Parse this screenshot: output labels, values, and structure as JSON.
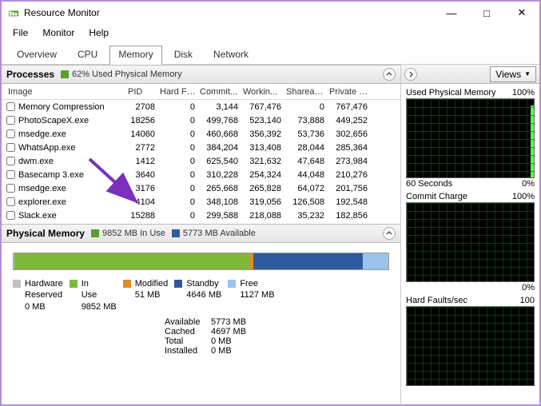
{
  "window": {
    "title": "Resource Monitor"
  },
  "menu": [
    "File",
    "Monitor",
    "Help"
  ],
  "tabs": {
    "items": [
      "Overview",
      "CPU",
      "Memory",
      "Disk",
      "Network"
    ],
    "active": 2
  },
  "processes": {
    "title": "Processes",
    "stat": {
      "color": "#5aa02c",
      "text": "62% Used Physical Memory"
    },
    "columns": [
      "Image",
      "PID",
      "Hard Fa...",
      "Commit...",
      "Workin...",
      "Shareab...",
      "Private (..."
    ],
    "rows": [
      {
        "image": "Memory Compression",
        "pid": "2708",
        "hard": "0",
        "commit": "3,144",
        "working": "767,476",
        "share": "0",
        "private": "767,476"
      },
      {
        "image": "PhotoScapeX.exe",
        "pid": "18256",
        "hard": "0",
        "commit": "499,768",
        "working": "523,140",
        "share": "73,888",
        "private": "449,252"
      },
      {
        "image": "msedge.exe",
        "pid": "14060",
        "hard": "0",
        "commit": "460,668",
        "working": "356,392",
        "share": "53,736",
        "private": "302,656"
      },
      {
        "image": "WhatsApp.exe",
        "pid": "2772",
        "hard": "0",
        "commit": "384,204",
        "working": "313,408",
        "share": "28,044",
        "private": "285,364"
      },
      {
        "image": "dwm.exe",
        "pid": "1412",
        "hard": "0",
        "commit": "625,540",
        "working": "321,632",
        "share": "47,648",
        "private": "273,984"
      },
      {
        "image": "Basecamp 3.exe",
        "pid": "3640",
        "hard": "0",
        "commit": "310,228",
        "working": "254,324",
        "share": "44,048",
        "private": "210,276"
      },
      {
        "image": "msedge.exe",
        "pid": "3176",
        "hard": "0",
        "commit": "265,668",
        "working": "265,828",
        "share": "64,072",
        "private": "201,756"
      },
      {
        "image": "explorer.exe",
        "pid": "4104",
        "hard": "0",
        "commit": "348,108",
        "working": "319,056",
        "share": "126,508",
        "private": "192,548"
      },
      {
        "image": "Slack.exe",
        "pid": "15288",
        "hard": "0",
        "commit": "299,588",
        "working": "218,088",
        "share": "35,232",
        "private": "182,856"
      }
    ]
  },
  "physicalMemory": {
    "title": "Physical Memory",
    "statusA": {
      "color": "#5aa02c",
      "text": "9852 MB In Use"
    },
    "statusB": {
      "color": "#2e5aa0",
      "text": "5773 MB Available"
    },
    "bar": [
      {
        "label": "Hardware Reserved",
        "color": "#bfbfbf",
        "value": "0 MB",
        "flex": 1
      },
      {
        "label": "In Use",
        "color": "#7fb93b",
        "value": "9852 MB",
        "flex": 280
      },
      {
        "label": "Modified",
        "color": "#e68a1f",
        "value": "51 MB",
        "flex": 4
      },
      {
        "label": "Standby",
        "color": "#2e5aa0",
        "value": "4646 MB",
        "flex": 130
      },
      {
        "label": "Free",
        "color": "#9cc3ec",
        "value": "1127 MB",
        "flex": 30
      }
    ],
    "stats": [
      {
        "k": "Available",
        "v": "5773 MB"
      },
      {
        "k": "Cached",
        "v": "4697 MB"
      },
      {
        "k": "Total",
        "v": "0 MB"
      },
      {
        "k": "Installed",
        "v": "0 MB"
      }
    ]
  },
  "right": {
    "viewsLabel": "Views",
    "graphs": [
      {
        "title": "Used Physical Memory",
        "max": "100%",
        "footL": "60 Seconds",
        "footR": "0%",
        "spike": 92
      },
      {
        "title": "Commit Charge",
        "max": "100%",
        "footL": "",
        "footR": "0%",
        "spike": 0
      },
      {
        "title": "Hard Faults/sec",
        "max": "100",
        "footL": "",
        "footR": "",
        "spike": 0
      }
    ]
  }
}
